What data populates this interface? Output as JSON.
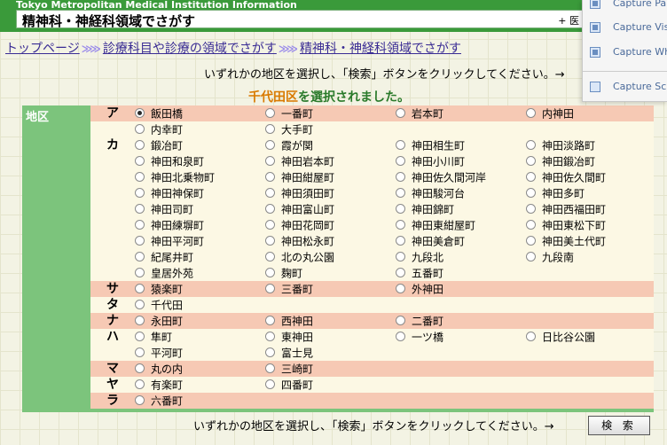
{
  "header": {
    "brand": "Tokyo Metropolitan Medical Institution Information",
    "title": "精神科・神経科領域でさがす",
    "more": "+ 医"
  },
  "breadcrumb": {
    "items": [
      "トップページ",
      "診療科目や診療の領域でさがす",
      "精神科・神経科領域でさがす"
    ],
    "separator": "≫"
  },
  "instruction_top": "いずれかの地区を選択し、「検索」ボタンをクリックしてください。→",
  "selected_message": {
    "ward": "千代田区",
    "suffix": "を選択されました。"
  },
  "area_label": "地区",
  "rows": [
    {
      "kana": "ア",
      "bg": "pink",
      "options": [
        {
          "label": "飯田橋",
          "checked": true
        },
        {
          "label": "一番町"
        },
        {
          "label": "岩本町"
        },
        {
          "label": "内神田"
        }
      ]
    },
    {
      "kana": "",
      "bg": "cream",
      "options": [
        {
          "label": "内幸町"
        },
        {
          "label": "大手町"
        }
      ]
    },
    {
      "kana": "カ",
      "bg": "cream",
      "options": [
        {
          "label": "鍛冶町"
        },
        {
          "label": "霞が関"
        },
        {
          "label": "神田相生町"
        },
        {
          "label": "神田淡路町"
        }
      ]
    },
    {
      "kana": "",
      "bg": "cream",
      "options": [
        {
          "label": "神田和泉町"
        },
        {
          "label": "神田岩本町"
        },
        {
          "label": "神田小川町"
        },
        {
          "label": "神田鍛冶町"
        }
      ]
    },
    {
      "kana": "",
      "bg": "cream",
      "options": [
        {
          "label": "神田北乗物町"
        },
        {
          "label": "神田紺屋町"
        },
        {
          "label": "神田佐久間河岸"
        },
        {
          "label": "神田佐久間町"
        }
      ]
    },
    {
      "kana": "",
      "bg": "cream",
      "options": [
        {
          "label": "神田神保町"
        },
        {
          "label": "神田須田町"
        },
        {
          "label": "神田駿河台"
        },
        {
          "label": "神田多町"
        }
      ]
    },
    {
      "kana": "",
      "bg": "cream",
      "options": [
        {
          "label": "神田司町"
        },
        {
          "label": "神田富山町"
        },
        {
          "label": "神田錦町"
        },
        {
          "label": "神田西福田町"
        }
      ]
    },
    {
      "kana": "",
      "bg": "cream",
      "options": [
        {
          "label": "神田練塀町"
        },
        {
          "label": "神田花岡町"
        },
        {
          "label": "神田東紺屋町"
        },
        {
          "label": "神田東松下町"
        }
      ]
    },
    {
      "kana": "",
      "bg": "cream",
      "options": [
        {
          "label": "神田平河町"
        },
        {
          "label": "神田松永町"
        },
        {
          "label": "神田美倉町"
        },
        {
          "label": "神田美土代町"
        }
      ]
    },
    {
      "kana": "",
      "bg": "cream",
      "options": [
        {
          "label": "紀尾井町"
        },
        {
          "label": "北の丸公園"
        },
        {
          "label": "九段北"
        },
        {
          "label": "九段南"
        }
      ]
    },
    {
      "kana": "",
      "bg": "cream",
      "options": [
        {
          "label": "皇居外苑"
        },
        {
          "label": "麹町"
        },
        {
          "label": "五番町"
        }
      ]
    },
    {
      "kana": "サ",
      "bg": "pink",
      "options": [
        {
          "label": "猿楽町"
        },
        {
          "label": "三番町"
        },
        {
          "label": "外神田"
        }
      ]
    },
    {
      "kana": "タ",
      "bg": "cream",
      "options": [
        {
          "label": "千代田"
        }
      ]
    },
    {
      "kana": "ナ",
      "bg": "pink",
      "options": [
        {
          "label": "永田町"
        },
        {
          "label": "西神田"
        },
        {
          "label": "二番町"
        }
      ]
    },
    {
      "kana": "ハ",
      "bg": "cream",
      "options": [
        {
          "label": "隼町"
        },
        {
          "label": "東神田"
        },
        {
          "label": "一ツ橋"
        },
        {
          "label": "日比谷公園"
        }
      ]
    },
    {
      "kana": "",
      "bg": "cream",
      "options": [
        {
          "label": "平河町"
        },
        {
          "label": "富士見"
        }
      ]
    },
    {
      "kana": "マ",
      "bg": "pink",
      "options": [
        {
          "label": "丸の内"
        },
        {
          "label": "三崎町"
        }
      ]
    },
    {
      "kana": "ヤ",
      "bg": "cream",
      "options": [
        {
          "label": "有楽町"
        },
        {
          "label": "四番町"
        }
      ]
    },
    {
      "kana": "ラ",
      "bg": "pink",
      "options": [
        {
          "label": "六番町"
        }
      ]
    }
  ],
  "instruction_bottom": "いずれかの地区を選択し、「検索」ボタンをクリックしてください。→",
  "search_button": "検 索",
  "popup": {
    "items": [
      "Capture Pa",
      "Capture Vis",
      "Capture Wh",
      "Capture Sc"
    ]
  },
  "colors": {
    "header_green": "#3a9a3a",
    "panel_green": "#7cc47c",
    "row_pink": "#f6c9b4",
    "row_cream": "#fcf8e4",
    "link": "#3a2c94",
    "ward_orange": "#d97a00"
  }
}
